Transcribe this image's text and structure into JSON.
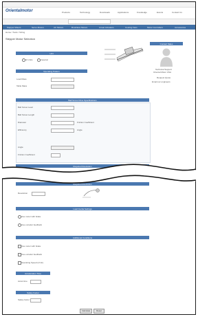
{
  "site": {
    "logo": "Orientalmotor"
  },
  "nav": {
    "items": [
      "Products",
      "Technology",
      "Downloads",
      "Applications",
      "Knowledge",
      "Events",
      "Contact Us"
    ]
  },
  "tabs": [
    "Stepper Motors",
    "Servo Motors",
    "AC Motors",
    "Brushless Motors",
    "Linear Actuators",
    "Cooling Fans",
    "Motor Controllers",
    "Accessories"
  ],
  "page": {
    "title": "Stepper Motor Selection",
    "breadcrumb": "Home / Tools / Sizing"
  },
  "sections": {
    "unit": "Unit",
    "operating": "Operating Pattern",
    "ballscrew": "Ball Screw Drive Specifications",
    "required_torque": "Required Resolution",
    "load_inertia": "Load Inertia Settings",
    "motor_conditions": "Additional Conditions",
    "acceleration": "Acceleration Time",
    "safety": "Safety Factor"
  },
  "contact": {
    "header": "Contact Sales",
    "name": "Technical Support",
    "line1": "Oriental Motor USA",
    "line2": "Request Quote",
    "link": "Email our engineers"
  },
  "buttons": {
    "calculate": "Calculate",
    "reset": "Reset"
  },
  "radio": {
    "option_a": "SI Units",
    "option_b": "Imperial"
  },
  "labels": {
    "load_mass": "Load Mass",
    "table_mass": "Table Mass",
    "lead": "Ball Screw Lead",
    "length": "Ball Screw Length",
    "diameter": "Diameter",
    "efficiency": "Efficiency",
    "friction": "Friction Coefficient",
    "angle": "Angle",
    "resolution": "Resolution",
    "cond1": "Use motor with brake",
    "cond2": "Use encoder feedback",
    "cond3": "Operating Speed (r/min)",
    "accel": "Accel time",
    "safety": "Safety factor"
  }
}
